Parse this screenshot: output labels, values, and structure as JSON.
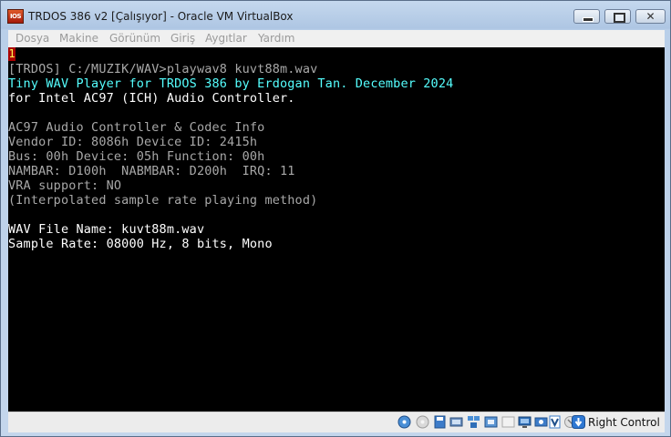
{
  "window": {
    "title": "TRDOS 386 v2 [Çalışıyor] - Oracle VM VirtualBox",
    "app_icon_text": "IOS"
  },
  "menu": {
    "items": [
      "Dosya",
      "Makine",
      "Görünüm",
      "Giriş",
      "Aygıtlar",
      "Yardım"
    ]
  },
  "console": {
    "marker": "1",
    "lines": [
      "[TRDOS] C:/MUZIK/WAV>playwav8 kuvt88m.wav",
      "Tiny WAV Player for TRDOS 386 by Erdogan Tan. December 2024",
      "for Intel AC97 (ICH) Audio Controller.",
      "",
      "AC97 Audio Controller & Codec Info",
      "Vendor ID: 8086h Device ID: 2415h",
      "Bus: 00h Device: 05h Function: 00h",
      "NAMBAR: D100h  NABMBAR: D200h  IRQ: 11",
      "VRA support: NO",
      "(Interpolated sample rate playing method)",
      "",
      "WAV File Name: kuvt88m.wav",
      "Sample Rate: 08000 Hz, 8 bits, Mono"
    ]
  },
  "statusbar": {
    "host_key_label": "Right Control",
    "icons": [
      "optical-drive-icon",
      "floppy-icon",
      "hard-disk-icon",
      "audio-icon",
      "network-icon",
      "usb-icon",
      "shared-folder-icon",
      "display-icon",
      "video-capture-icon",
      "virtualization-icon",
      "mouse-integration-icon",
      "host-key-arrow-icon"
    ]
  }
}
